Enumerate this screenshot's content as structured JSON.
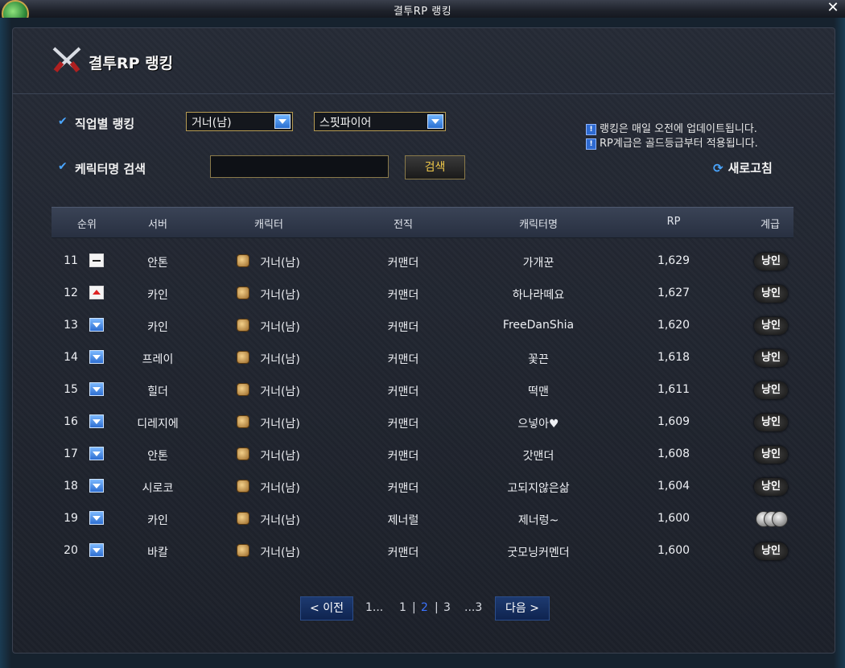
{
  "window": {
    "title": "결투RP 랭킹",
    "close": "✕"
  },
  "header": {
    "title": "결투RP 랭킹"
  },
  "filters": {
    "job_label": "직업별 랭킹",
    "job_select": "거너(남)",
    "sub_select": "스핏파이어",
    "name_label": "케릭터명 검색",
    "search_button": "검색",
    "check_mark": "✔"
  },
  "notices": [
    "랭킹은 매일 오전에 업데이트됩니다.",
    "RP계급은 골드등급부터 적용됩니다."
  ],
  "refresh": {
    "icon": "⟳",
    "label": "새로고침"
  },
  "table": {
    "headers": [
      "순위",
      "서버",
      "캐릭터",
      "전직",
      "캐릭터명",
      "RP",
      "계급"
    ],
    "rows": [
      {
        "rank": "11",
        "change": "same",
        "server": "안톤",
        "class": "거너(남)",
        "adv": "커맨더",
        "name": "가개꾼",
        "rp": "1,629",
        "tier": "낭인"
      },
      {
        "rank": "12",
        "change": "up",
        "server": "카인",
        "class": "거너(남)",
        "adv": "커맨더",
        "name": "하나라떼요",
        "rp": "1,627",
        "tier": "낭인"
      },
      {
        "rank": "13",
        "change": "down",
        "server": "카인",
        "class": "거너(남)",
        "adv": "커맨더",
        "name": "FreeDanShia",
        "rp": "1,620",
        "tier": "낭인"
      },
      {
        "rank": "14",
        "change": "down",
        "server": "프레이",
        "class": "거너(남)",
        "adv": "커맨더",
        "name": "꽃끈",
        "rp": "1,618",
        "tier": "낭인"
      },
      {
        "rank": "15",
        "change": "down",
        "server": "힐더",
        "class": "거너(남)",
        "adv": "커맨더",
        "name": "떡맨",
        "rp": "1,611",
        "tier": "낭인"
      },
      {
        "rank": "16",
        "change": "down",
        "server": "디레지에",
        "class": "거너(남)",
        "adv": "커맨더",
        "name": "으넣아♥",
        "rp": "1,609",
        "tier": "낭인"
      },
      {
        "rank": "17",
        "change": "down",
        "server": "안톤",
        "class": "거너(남)",
        "adv": "커맨더",
        "name": "갓맨더",
        "rp": "1,608",
        "tier": "낭인"
      },
      {
        "rank": "18",
        "change": "down",
        "server": "시로코",
        "class": "거너(남)",
        "adv": "커맨더",
        "name": "고되지않은삶",
        "rp": "1,604",
        "tier": "낭인"
      },
      {
        "rank": "19",
        "change": "down",
        "server": "카인",
        "class": "거너(남)",
        "adv": "제너럴",
        "name": "제너렁~",
        "rp": "1,600",
        "tier": ""
      },
      {
        "rank": "20",
        "change": "down",
        "server": "바칼",
        "class": "거너(남)",
        "adv": "커맨더",
        "name": "굿모닝커멘더",
        "rp": "1,600",
        "tier": "낭인"
      }
    ]
  },
  "pagination": {
    "prev": "< 이전",
    "first": "1...",
    "pages": [
      "1",
      "2",
      "3"
    ],
    "current": "2",
    "last": "...3",
    "next": "다음 >"
  }
}
